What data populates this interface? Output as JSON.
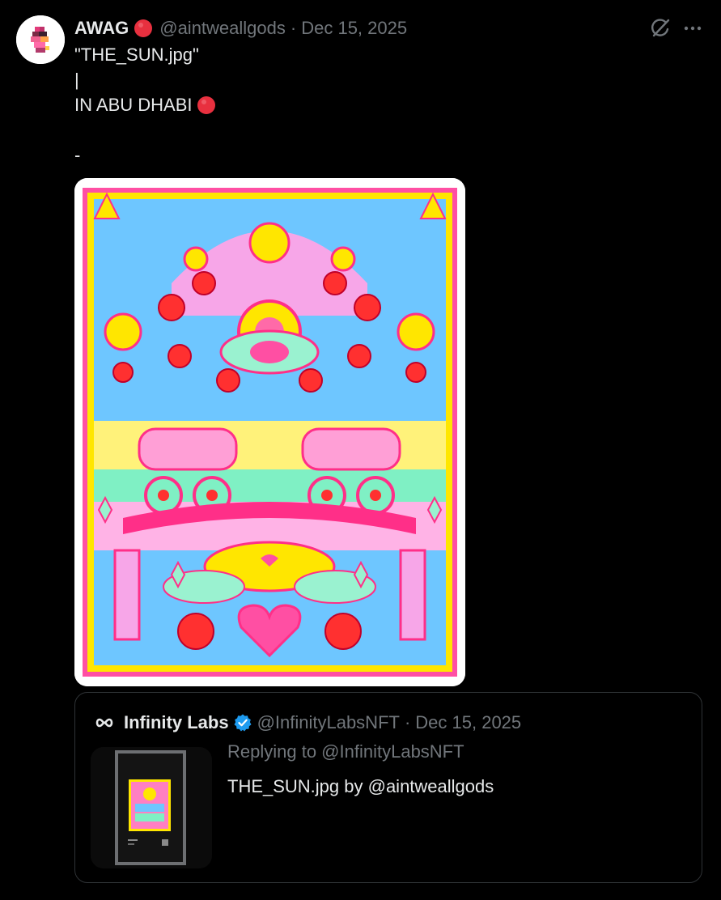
{
  "tweet": {
    "author": {
      "display_name": "AWAG",
      "handle": "@aintweallgods",
      "badge_icon": "red-circle-emoji",
      "avatar_icon": "pixel-art-avatar"
    },
    "separator": "·",
    "date": "Dec 15, 2025",
    "body_lines": [
      "\"THE_SUN.jpg\"",
      "|",
      "IN ABU DHABI",
      "",
      "-"
    ],
    "media_icon": "psychedelic-sun-artwork",
    "actions": {
      "grok_icon": "grok-icon",
      "more_icon": "more-dots-icon"
    }
  },
  "quote": {
    "author": {
      "display_name": "Infinity Labs",
      "handle": "@InfinityLabsNFT",
      "logo_icon": "infinity-icon",
      "verified_icon": "verified-badge-icon"
    },
    "separator": "·",
    "date": "Dec 15, 2025",
    "reply_context": "Replying to @InfinityLabsNFT",
    "text": "THE_SUN.jpg by @aintweallgods",
    "thumbnail_icon": "framed-artwork-thumbnail"
  },
  "colors": {
    "background": "#000000",
    "primary_text": "#e7e9ea",
    "secondary_text": "#71767b",
    "border": "#2f3336",
    "red_emoji": "#e8303f",
    "verified_blue": "#1d9bf0"
  }
}
